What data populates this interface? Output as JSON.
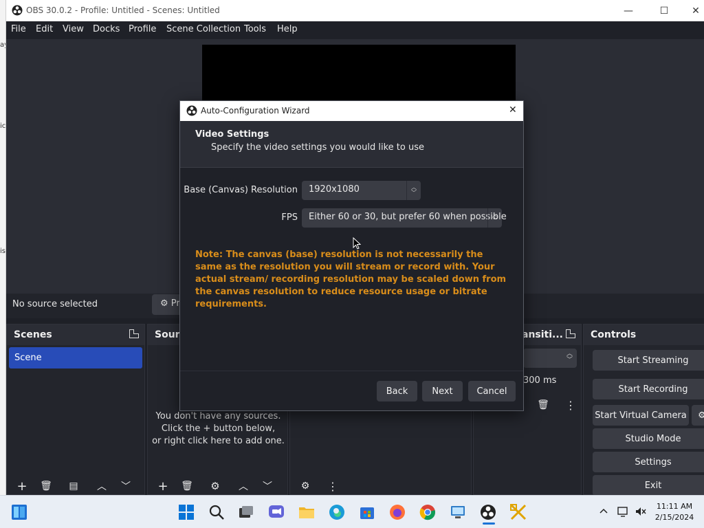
{
  "desktop_fragments": [
    "ay",
    "ic",
    "is"
  ],
  "window": {
    "title": "OBS 30.0.2 - Profile: Untitled - Scenes: Untitled",
    "minimize": "—",
    "maximize": "☐",
    "close": "✕"
  },
  "menu": [
    "File",
    "Edit",
    "View",
    "Docks",
    "Profile",
    "Scene Collection",
    "Tools",
    "Help"
  ],
  "source_bar": {
    "status": "No source selected",
    "properties_label": "Pr"
  },
  "scenes_dock": {
    "title": "Scenes",
    "items": [
      "Scene"
    ]
  },
  "sources_dock": {
    "title": "Sourc",
    "empty_line1": "You don't have any sources.",
    "empty_line2": "Click the + button below,",
    "empty_line3": "or right click here to add one."
  },
  "transitions_dock": {
    "title": "ansiti...",
    "duration": "300 ms"
  },
  "controls_dock": {
    "title": "Controls",
    "buttons": [
      "Start Streaming",
      "Start Recording",
      "Start Virtual Camera",
      "Studio Mode",
      "Settings",
      "Exit"
    ]
  },
  "dialog": {
    "title": "Auto-Configuration Wizard",
    "close": "✕",
    "heading": "Video Settings",
    "subheading": "Specify the video settings you would like to use",
    "base_resolution_label": "Base (Canvas) Resolution",
    "base_resolution_value": "1920x1080",
    "fps_label": "FPS",
    "fps_value": "Either 60 or 30, but prefer 60 when possible",
    "note": "Note: The canvas (base) resolution is not necessarily the same as the resolution you will stream or record with. Your actual stream/ recording resolution may be scaled down from the canvas resolution to reduce resource usage or bitrate requirements.",
    "back": "Back",
    "next": "Next",
    "cancel": "Cancel"
  },
  "taskbar": {
    "time": "11:11 AM",
    "date": "2/15/2024"
  },
  "colors": {
    "accent": "#284cb8",
    "note": "#d98d1a",
    "button": "#3a3c44"
  }
}
